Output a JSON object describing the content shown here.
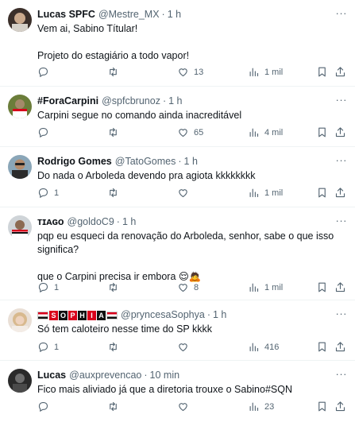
{
  "tweets": [
    {
      "name": "Lucas SPFC",
      "handle": "@Mestre_MX",
      "time": "1 h",
      "text": "Vem ai, Sabino Títular!\n\nProjeto do estagiário a todo vapor!",
      "replies": "",
      "retweets": "",
      "likes": "13",
      "views": "1 mil"
    },
    {
      "name": "#ForaCarpini",
      "handle": "@spfcbrunoz",
      "time": "1 h",
      "text": "Carpini segue no comando ainda inacreditável",
      "replies": "",
      "retweets": "",
      "likes": "65",
      "views": "4 mil"
    },
    {
      "name": "Rodrigo Gomes",
      "handle": "@TatoGomes",
      "time": "1 h",
      "text": "Do nada o Arboleda devendo pra agiota kkkkkkkk",
      "replies": "1",
      "retweets": "",
      "likes": "",
      "views": "1 mil"
    },
    {
      "name": "ᴛɪᴀɢᴏ",
      "handle": "@goldoC9",
      "time": "1 h",
      "text": "pqp eu esqueci da renovação do Arboleda, senhor, sabe o que isso significa?\n\nque o Carpini precisa ir embora 😌🙇",
      "replies": "1",
      "retweets": "",
      "likes": "8",
      "views": "1 mil"
    },
    {
      "name": "SOPHIA",
      "handle": "@pryncesaSophya",
      "time": "1 h",
      "text": "Só tem caloteiro nesse time do SP kkkk",
      "replies": "1",
      "retweets": "",
      "likes": "",
      "views": "416"
    },
    {
      "name": "Lucas",
      "handle": "@auxprevencao",
      "time": "10 min",
      "text": "Fico mais aliviado já que a diretoria trouxe o Sabino#SQN",
      "replies": "",
      "retweets": "",
      "likes": "",
      "views": "23"
    }
  ],
  "more_label": "···",
  "dot": "·",
  "colors": {
    "text": "#0f1419",
    "muted": "#536471",
    "divider": "#eff3f4"
  }
}
